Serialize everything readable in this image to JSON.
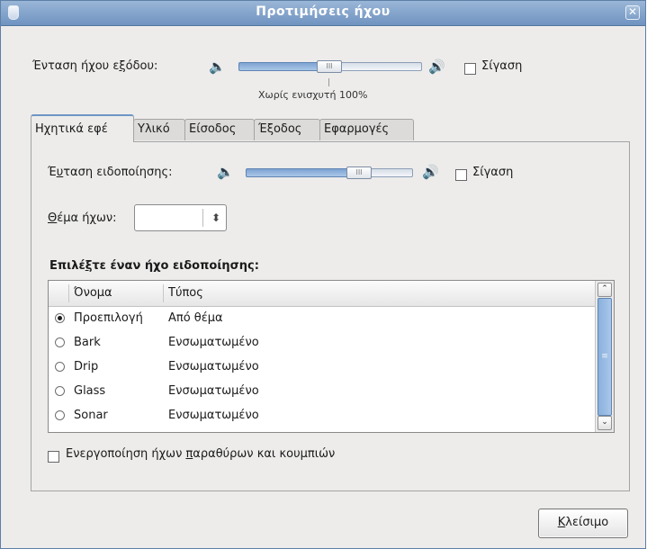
{
  "window": {
    "title": "Προτιμήσεις ήχου",
    "close_symbol": "✕"
  },
  "output": {
    "label_pre": "Ένταση ήχου ε",
    "label_mnemonic": "ξ",
    "label_post": "όδου:",
    "level_percent": 50,
    "amplification_label": "Χωρίς ενισχυτή 100%",
    "mute_label": "Σίγαση",
    "muted": false
  },
  "tabs": [
    {
      "label": "Ηχητικά εφέ",
      "active": true
    },
    {
      "label": "Υλικό",
      "active": false
    },
    {
      "label": "Είσοδος",
      "active": false
    },
    {
      "label": "Έξοδος",
      "active": false
    },
    {
      "label": "Εφαρμογές",
      "active": false
    }
  ],
  "effects": {
    "alert_label_pre": "Έ",
    "alert_label_mnemonic": "υ",
    "alert_label_post": "ταση ειδοποίησης:",
    "alert_level_percent": 74,
    "mute_label": "Σίγαση",
    "muted": false,
    "theme_label_mnemonic": "Θ",
    "theme_label_post": "έμα ήχων:",
    "theme_value": "",
    "choose_pre": "Επιλέ",
    "choose_mnemonic": "ξ",
    "choose_post": "τε έναν ήχο ειδοποίησης:",
    "columns": [
      "Όνομα",
      "Τύπος"
    ],
    "rows": [
      {
        "name": "Προεπιλογή",
        "type": "Από θέμα",
        "selected": true
      },
      {
        "name": "Bark",
        "type": "Ενσωματωμένο",
        "selected": false
      },
      {
        "name": "Drip",
        "type": "Ενσωματωμένο",
        "selected": false
      },
      {
        "name": "Glass",
        "type": "Ενσωματωμένο",
        "selected": false
      },
      {
        "name": "Sonar",
        "type": "Ενσωματωμένο",
        "selected": false
      }
    ],
    "window_sounds_pre": "Ενεργοποίηση ήχων ",
    "window_sounds_mnemonic": "π",
    "window_sounds_post": "αραθύρων και κουμπιών",
    "window_sounds_checked": false
  },
  "footer": {
    "close_mnemonic": "Κ",
    "close_post": "λείσιμο"
  },
  "icons": {
    "speaker_low": "🔈",
    "speaker_high": "🔊",
    "thumb_grip": "III",
    "updown": "⬍",
    "scroll_up": "⌃",
    "scroll_down": "⌄",
    "scroll_grip": "≡"
  },
  "colors": {
    "titlebar": "#7f9fc9",
    "accent": "#6d94c4"
  }
}
